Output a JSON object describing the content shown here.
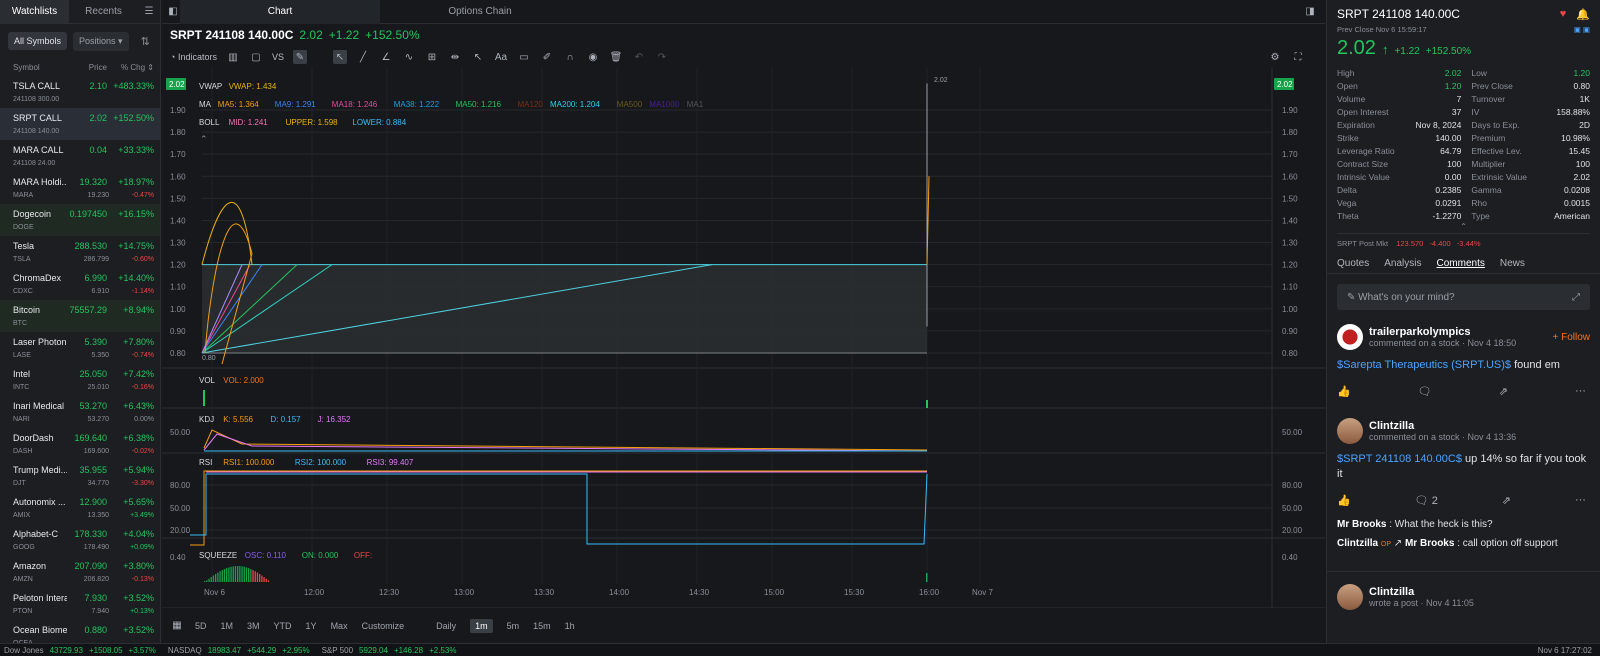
{
  "left": {
    "tabs": [
      "Watchlists",
      "Recents"
    ],
    "filter_all": "All Symbols",
    "filter_pos": "Positions",
    "cols": [
      "Symbol",
      "Price",
      "% Chg"
    ],
    "items": [
      {
        "name": "TSLA CALL",
        "price": "2.10",
        "chg": "+483.33%",
        "sub": "241108 300.00",
        "sp": "",
        "sc": "",
        "cls": ""
      },
      {
        "name": "SRPT CALL",
        "price": "2.02",
        "chg": "+152.50%",
        "sub": "241108 140.00",
        "sp": "",
        "sc": "",
        "cls": "sel"
      },
      {
        "name": "MARA CALL",
        "price": "0.04",
        "chg": "+33.33%",
        "sub": "241108 24.00",
        "sp": "",
        "sc": "",
        "cls": ""
      },
      {
        "name": "MARA Holdi...",
        "price": "19.320",
        "chg": "+18.97%",
        "sub": "MARA",
        "sp": "19.230",
        "sc": "-0.47%",
        "cls": ""
      },
      {
        "name": "Dogecoin",
        "price": "0.197450",
        "chg": "+16.15%",
        "sub": "DOGE",
        "sp": "",
        "sc": "",
        "cls": "hl"
      },
      {
        "name": "Tesla",
        "price": "288.530",
        "chg": "+14.75%",
        "sub": "TSLA",
        "sp": "286.799",
        "sc": "-0.60%",
        "cls": ""
      },
      {
        "name": "ChromaDex",
        "price": "6.990",
        "chg": "+14.40%",
        "sub": "CDXC",
        "sp": "6.910",
        "sc": "-1.14%",
        "cls": ""
      },
      {
        "name": "Bitcoin",
        "price": "75557.29",
        "chg": "+8.94%",
        "sub": "BTC",
        "sp": "",
        "sc": "",
        "cls": "hl"
      },
      {
        "name": "Laser Photoni...",
        "price": "5.390",
        "chg": "+7.80%",
        "sub": "LASE",
        "sp": "5.350",
        "sc": "-0.74%",
        "cls": ""
      },
      {
        "name": "Intel",
        "price": "25.050",
        "chg": "+7.42%",
        "sub": "INTC",
        "sp": "25.010",
        "sc": "-0.16%",
        "cls": ""
      },
      {
        "name": "Inari Medical",
        "price": "53.270",
        "chg": "+6.43%",
        "sub": "NARI",
        "sp": "53.270",
        "sc": "0.00%",
        "cls": ""
      },
      {
        "name": "DoorDash",
        "price": "169.640",
        "chg": "+6.38%",
        "sub": "DASH",
        "sp": "169.600",
        "sc": "-0.02%",
        "cls": ""
      },
      {
        "name": "Trump Medi...",
        "price": "35.955",
        "chg": "+5.94%",
        "sub": "DJT",
        "sp": "34.770",
        "sc": "-3.30%",
        "cls": ""
      },
      {
        "name": "Autonomix ...",
        "price": "12.900",
        "chg": "+5.65%",
        "sub": "AMIX",
        "sp": "13.350",
        "sc": "+3.49%",
        "cls": ""
      },
      {
        "name": "Alphabet-C",
        "price": "178.330",
        "chg": "+4.04%",
        "sub": "GOOG",
        "sp": "178.490",
        "sc": "+0.09%",
        "cls": ""
      },
      {
        "name": "Amazon",
        "price": "207.090",
        "chg": "+3.80%",
        "sub": "AMZN",
        "sp": "206.820",
        "sc": "-0.13%",
        "cls": ""
      },
      {
        "name": "Peloton Intera...",
        "price": "7.930",
        "chg": "+3.52%",
        "sub": "PTON",
        "sp": "7.940",
        "sc": "+0.13%",
        "cls": ""
      },
      {
        "name": "Ocean Biome...",
        "price": "0.880",
        "chg": "+3.52%",
        "sub": "OCEA",
        "sp": "",
        "sc": "",
        "cls": ""
      }
    ]
  },
  "center": {
    "tabs": [
      "Chart",
      "Options Chain"
    ],
    "symbol": "SRPT 241108 140.00C",
    "price": "2.02",
    "change": "+1.22",
    "pct": "+152.50%",
    "indicators": "Indicators",
    "vs": "VS",
    "ind_vwap": "VWAP",
    "ind_vwap_v": "VWAP: 1.434",
    "ma_label": "MA",
    "ma": [
      "MA5: 1.364",
      "MA9: 1.291",
      "MA18: 1.246",
      "MA38: 1.222",
      "MA50: 1.216",
      "MA120",
      "MA200: 1.204",
      "MA500",
      "MA1000",
      "MA1"
    ],
    "boll_label": "BOLL",
    "boll": [
      "MID: 1.241",
      "UPPER: 1.598",
      "LOWER: 0.884"
    ],
    "vol_label": "VOL",
    "vol_v": "VOL: 2.000",
    "kdj_label": "KDJ",
    "kdj": [
      "K: 5.556",
      "D: 0.157",
      "J: 16.352"
    ],
    "rsi_label": "RSI",
    "rsi": [
      "RSI1: 100.000",
      "RSI2: 100.000",
      "RSI3: 99.407"
    ],
    "sq_label": "SQUEEZE",
    "sq": [
      "OSC: 0.110",
      "ON: 0.000",
      "OFF:"
    ],
    "price_tag": "2.02",
    "high_mark": "2.02",
    "low_mark": "0.80",
    "yticks": [
      "1.90",
      "1.80",
      "1.70",
      "1.60",
      "1.50",
      "1.40",
      "1.30",
      "1.20",
      "1.10",
      "1.00",
      "0.90",
      "0.80"
    ],
    "kdj_tick": "50.00",
    "rsi_ticks": [
      "80.00",
      "50.00",
      "20.00"
    ],
    "sq_tick": "0.40",
    "xticks": [
      "Nov 6",
      "12:00",
      "12:30",
      "13:00",
      "13:30",
      "14:00",
      "14:30",
      "15:00",
      "15:30",
      "16:00",
      "Nov 7"
    ],
    "periods": [
      "5D",
      "1M",
      "3M",
      "YTD",
      "1Y",
      "Max",
      "Customize"
    ],
    "intervals": [
      "Daily",
      "1m",
      "5m",
      "15m",
      "1h"
    ],
    "active_interval": "1m"
  },
  "right": {
    "title": "SRPT 241108 140.00C",
    "prev": "Prev Close Nov 6 15:59:17",
    "price": "2.02",
    "change": "+1.22",
    "pct": "+152.50%",
    "stats": [
      [
        "High",
        "2.02",
        "Low",
        "1.20"
      ],
      [
        "Open",
        "1.20",
        "Prev Close",
        "0.80"
      ],
      [
        "Volume",
        "7",
        "Turnover",
        "1K"
      ],
      [
        "Open Interest",
        "37",
        "IV",
        "158.88%"
      ],
      [
        "Expiration",
        "Nov 8, 2024",
        "Days to Exp.",
        "2D"
      ],
      [
        "Strike",
        "140.00",
        "Premium",
        "10.98%"
      ],
      [
        "Leverage Ratio",
        "64.79",
        "Effective Lev.",
        "15.45"
      ],
      [
        "Contract Size",
        "100",
        "Multiplier",
        "100"
      ],
      [
        "Intrinsic Value",
        "0.00",
        "Extrinsic Value",
        "2.02"
      ],
      [
        "Delta",
        "0.2385",
        "Gamma",
        "0.0208"
      ],
      [
        "Vega",
        "0.0291",
        "Rho",
        "0.0015"
      ],
      [
        "Theta",
        "-1.2270",
        "Type",
        "American"
      ]
    ],
    "post_mkt": "SRPT Post Mkt",
    "post_vals": [
      "123.570",
      "-4.400",
      "-3.44%"
    ],
    "tabs": [
      "Quotes",
      "Analysis",
      "Comments",
      "News"
    ],
    "mind": "What's on your mind?",
    "post1": {
      "user": "trailerparkolympics",
      "meta": "commented on a stock · Nov 4 18:50",
      "tag": "$Sarepta Therapeutics (SRPT.US)$",
      "text": "found em",
      "follow": "Follow"
    },
    "post2": {
      "user": "Clintzilla",
      "meta": "commented on a stock · Nov 4 13:36",
      "tag": "$SRPT 241108 140.00C$",
      "text": "up 14% so far if you took it",
      "count": "2",
      "r1_user": "Mr Brooks",
      "r1_text": ": What the heck is this?",
      "r2_user": "Clintzilla",
      "r2_badge": "OP",
      "r2_to": "Mr Brooks",
      "r2_text": ": call option off support"
    },
    "post3": {
      "user": "Clintzilla",
      "meta": "wrote a post · Nov 4 11:05"
    }
  },
  "ticker": {
    "items": [
      "Dow Jones",
      "43729.93",
      "+1508.05",
      "+3.57%",
      "NASDAQ",
      "18983.47",
      "+544.29",
      "+2.95%",
      "S&P 500",
      "5929.04",
      "+146.28",
      "+2.53%"
    ],
    "time": "Nov 6 17:27:02"
  }
}
